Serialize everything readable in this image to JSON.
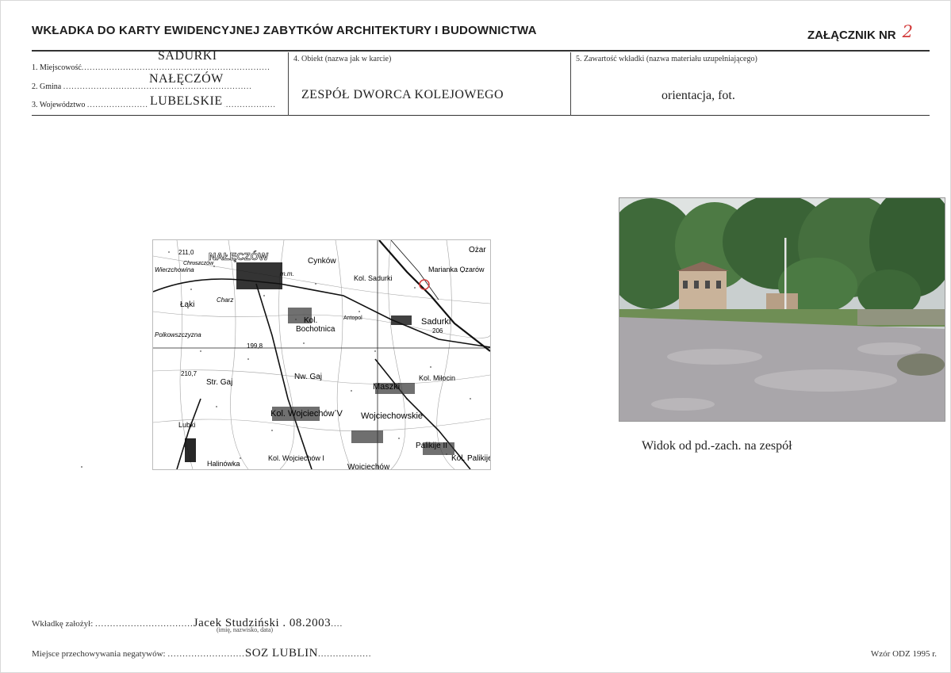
{
  "header": {
    "title": "WKŁADKA DO KARTY EWIDENCYJNEJ ZABYTKÓW ARCHITEKTURY I BUDOWNICTWA",
    "annex_label": "ZAŁĄCZNIK NR",
    "annex_number": "2"
  },
  "fields": {
    "locality_label": "1. Miejscowość",
    "locality_value": "SADURKI",
    "commune_label": "2. Gmina",
    "commune_value": "NAŁĘCZÓW",
    "voivodeship_label": "3. Województwo",
    "voivodeship_value": "LUBELSKIE",
    "object_label": "4. Obiekt (nazwa jak w karcie)",
    "object_value": "ZESPÓŁ DWORCA KOLEJOWEGO",
    "content_label": "5. Zawartość wkładki (nazwa materiału uzupełniającego)",
    "content_value": "orientacja, fot."
  },
  "map": {
    "labels": [
      "211,0",
      "NAŁĘCZÓW",
      "Chruszczów",
      "Wierzchowina",
      "Cynków",
      "Kol. Sadurki",
      "Marianka Ozarów",
      "Ożar",
      "m.m.",
      "Bochotnica",
      "Charz",
      "Łąki",
      "Kol.",
      "Antopol",
      "Sadurki",
      "206",
      "Polkowszczyzna",
      "199,8",
      "210,7",
      "Str. Gaj",
      "Nw. Gaj",
      "Kol. Miłocin",
      "Maszki",
      "Kol. Wojciechów V",
      "Wojciechowskie",
      "Lubki",
      "Kol. Wojciechów I",
      "Palikije II",
      "Kol. Palikije",
      "Halinówka",
      "Wojciechów"
    ]
  },
  "photo": {
    "caption": "Widok od pd.-zach. na zespół"
  },
  "footer": {
    "created_label": "Wkładkę założył:",
    "created_value": "Jacek Studziński . 08.2003",
    "created_hint": "(imię, nazwisko, data)",
    "storage_label": "Miejsce przechowywania negatywów:",
    "storage_value": "SOZ LUBLIN",
    "form_version": "Wzór ODZ 1995 r."
  },
  "colors": {
    "annex_number": "#d23a3a",
    "rule_lines": "#333333"
  }
}
